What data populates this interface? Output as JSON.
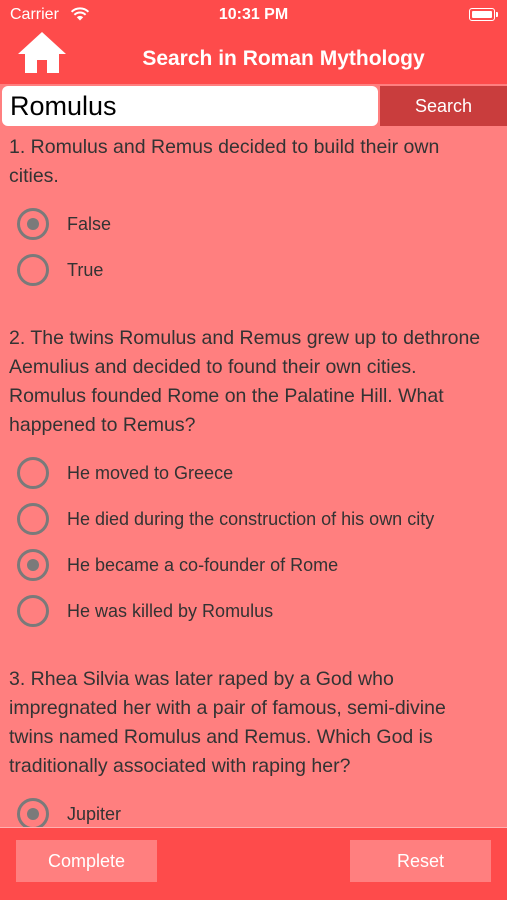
{
  "status_bar": {
    "carrier": "Carrier",
    "time": "10:31 PM"
  },
  "header": {
    "title": "Search in Roman Mythology",
    "home_icon": "home-icon"
  },
  "search": {
    "value": "Romulus",
    "button_label": "Search"
  },
  "questions": [
    {
      "text": "1. Romulus and Remus decided to build their own cities.",
      "options": [
        {
          "label": "False",
          "selected": true
        },
        {
          "label": "True",
          "selected": false
        }
      ]
    },
    {
      "text": "2. The twins Romulus and Remus grew up to dethrone Aemulius and decided to found their own cities. Romulus founded Rome on the Palatine Hill. What happened to Remus?",
      "options": [
        {
          "label": "He moved to Greece",
          "selected": false
        },
        {
          "label": "He died during the construction of his own city",
          "selected": false
        },
        {
          "label": "He became a co-founder of Rome",
          "selected": true
        },
        {
          "label": "He was killed by Romulus",
          "selected": false
        }
      ]
    },
    {
      "text": "3. Rhea Silvia was later raped by a God who impregnated her with a pair of famous, semi-divine twins named Romulus and Remus. Which God is traditionally associated with raping her?",
      "options": [
        {
          "label": "Jupiter",
          "selected": true
        }
      ]
    }
  ],
  "footer": {
    "complete_label": "Complete",
    "reset_label": "Reset"
  },
  "colors": {
    "header": "#fe4b4b",
    "background": "#ff7f7f",
    "search_button": "#c93d3d",
    "radio": "#7a7a7a"
  }
}
